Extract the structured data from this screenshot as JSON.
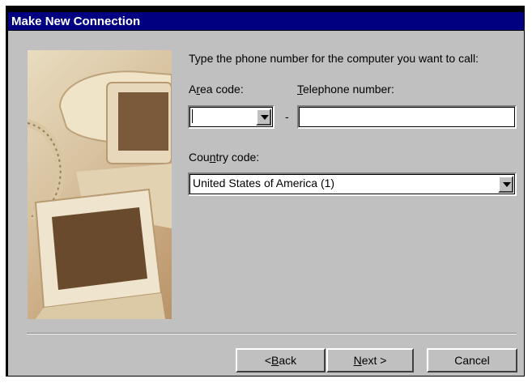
{
  "window": {
    "title": "Make New Connection"
  },
  "instruction": "Type the phone number for the computer you want to call:",
  "area_code": {
    "label_pre": "A",
    "label_u": "r",
    "label_post": "ea code:",
    "value": ""
  },
  "dash": "-",
  "telephone": {
    "label_u": "T",
    "label_post": "elephone number:",
    "value": ""
  },
  "country": {
    "label_pre": "Cou",
    "label_u": "n",
    "label_post": "try code:",
    "value": "United States of America (1)"
  },
  "buttons": {
    "back": {
      "prefix": "< ",
      "u": "B",
      "rest": "ack"
    },
    "next": {
      "u": "N",
      "rest": "ext >"
    },
    "cancel": "Cancel"
  },
  "illustration": {
    "icons": [
      "telephone-icon",
      "monitor-icon"
    ]
  },
  "colors": {
    "titlebar": "#000080",
    "face": "#c0c0c0"
  }
}
